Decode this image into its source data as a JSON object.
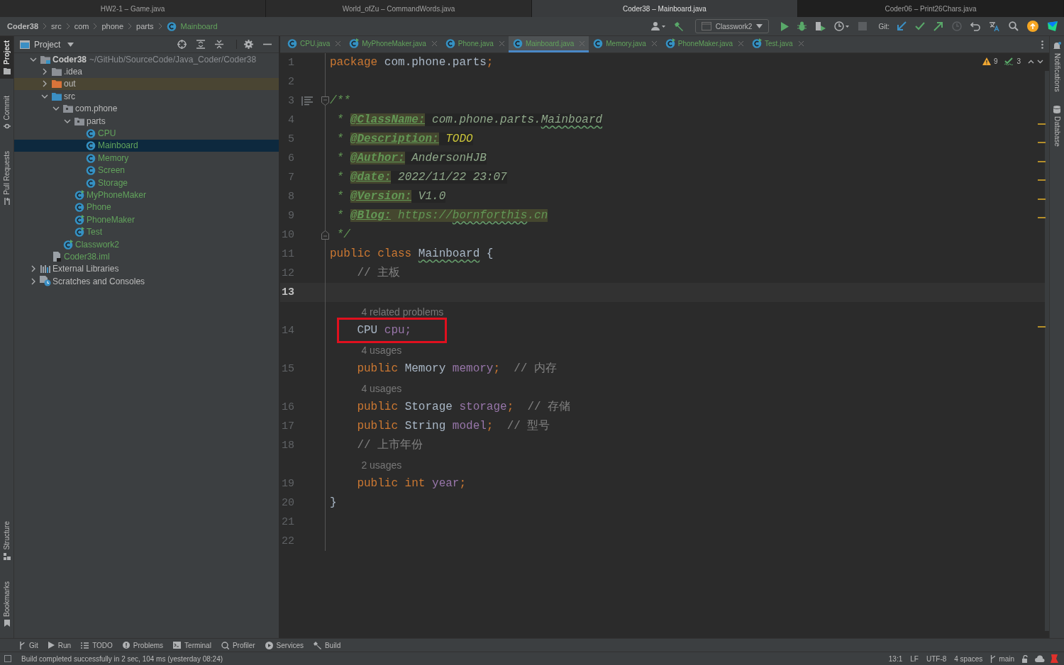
{
  "window_tabs": [
    {
      "label": "HW2-1 – Game.java",
      "selected": false
    },
    {
      "label": "World_ofZu – CommandWords.java",
      "selected": false
    },
    {
      "label": "Coder38 – Mainboard.java",
      "selected": true
    },
    {
      "label": "Coder06 – Print26Chars.java",
      "selected": false
    }
  ],
  "breadcrumb": [
    {
      "label": "Coder38",
      "kind": "project"
    },
    {
      "label": "src",
      "kind": "folder"
    },
    {
      "label": "com",
      "kind": "folder"
    },
    {
      "label": "phone",
      "kind": "folder"
    },
    {
      "label": "parts",
      "kind": "folder"
    },
    {
      "label": "Mainboard",
      "kind": "class"
    }
  ],
  "toolbar": {
    "run_config": "Classwork2",
    "git_label": "Git:"
  },
  "left_tools_top": [
    {
      "label": "Project",
      "selected": true,
      "kind": "project"
    },
    {
      "label": "Commit",
      "selected": false,
      "kind": "commit"
    },
    {
      "label": "Pull Requests",
      "selected": false,
      "kind": "pull"
    }
  ],
  "left_tools_bottom": [
    {
      "label": "Structure",
      "selected": false,
      "kind": "structure"
    },
    {
      "label": "Bookmarks",
      "selected": false,
      "kind": "bookmarks"
    }
  ],
  "right_tools": [
    {
      "label": "Notifications",
      "kind": "notifications"
    },
    {
      "label": "Database",
      "kind": "database"
    }
  ],
  "project_panel": {
    "title": "Project",
    "tree": [
      {
        "label": "Coder38",
        "kind": "module",
        "path": "~/GitHub/SourceCode/Java_Coder/Coder38",
        "expanded": true,
        "selected": false,
        "added": false,
        "children": [
          {
            "label": ".idea",
            "kind": "folder",
            "expanded": false,
            "selected": false,
            "added": false
          },
          {
            "label": "out",
            "kind": "excluded",
            "expanded": false,
            "selected": false,
            "added": false
          },
          {
            "label": "src",
            "kind": "source",
            "expanded": true,
            "selected": false,
            "added": false,
            "children": [
              {
                "label": "com.phone",
                "kind": "package",
                "expanded": true,
                "selected": false,
                "added": false,
                "children": [
                  {
                    "label": "parts",
                    "kind": "package",
                    "expanded": true,
                    "selected": false,
                    "added": false,
                    "children": [
                      {
                        "label": "CPU",
                        "kind": "class",
                        "selected": false,
                        "added": true
                      },
                      {
                        "label": "Mainboard",
                        "kind": "class",
                        "selected": true,
                        "added": true
                      },
                      {
                        "label": "Memory",
                        "kind": "class",
                        "selected": false,
                        "added": true
                      },
                      {
                        "label": "Screen",
                        "kind": "class",
                        "selected": false,
                        "added": true
                      },
                      {
                        "label": "Storage",
                        "kind": "class",
                        "selected": false,
                        "added": true
                      }
                    ]
                  },
                  {
                    "label": "MyPhoneMaker",
                    "kind": "main_class",
                    "selected": false,
                    "added": true
                  },
                  {
                    "label": "Phone",
                    "kind": "class",
                    "selected": false,
                    "added": true
                  },
                  {
                    "label": "PhoneMaker",
                    "kind": "main_class",
                    "selected": false,
                    "added": true
                  },
                  {
                    "label": "Test",
                    "kind": "main_class",
                    "selected": false,
                    "added": true
                  }
                ]
              },
              {
                "label": "Classwork2",
                "kind": "main_class",
                "selected": false,
                "added": true
              }
            ]
          },
          {
            "label": "Coder38.iml",
            "kind": "iml",
            "selected": false,
            "added": true
          }
        ]
      },
      {
        "label": "External Libraries",
        "kind": "libraries",
        "expanded": false,
        "selected": false,
        "added": false
      },
      {
        "label": "Scratches and Consoles",
        "kind": "scratches",
        "expanded": false,
        "selected": false,
        "added": false
      }
    ]
  },
  "editor_tabs": [
    {
      "label": "CPU.java",
      "kind": "class",
      "selected": false
    },
    {
      "label": "MyPhoneMaker.java",
      "kind": "main_class",
      "selected": false
    },
    {
      "label": "Phone.java",
      "kind": "class",
      "selected": false
    },
    {
      "label": "Mainboard.java",
      "kind": "class",
      "selected": true
    },
    {
      "label": "Memory.java",
      "kind": "class",
      "selected": false
    },
    {
      "label": "PhoneMaker.java",
      "kind": "main_class",
      "selected": false
    },
    {
      "label": "Test.java",
      "kind": "main_class",
      "selected": false
    }
  ],
  "inspections": {
    "warnings": "9",
    "typos": "3"
  },
  "code": [
    {
      "kind": "line",
      "number": "1",
      "tokens": [
        {
          "t": "package",
          "kind": "kw"
        },
        {
          "t": " com.phone.parts",
          "kind": "plain"
        },
        {
          "t": ";",
          "kind": "kw"
        }
      ]
    },
    {
      "kind": "line",
      "number": "2"
    },
    {
      "kind": "line",
      "number": "3",
      "doc_toggle": true,
      "fold_start": true,
      "tokens": [
        {
          "t": "/**",
          "kind": "doc"
        }
      ]
    },
    {
      "kind": "line",
      "number": "4",
      "tokens": [
        {
          "t": " * ",
          "kind": "doc"
        },
        {
          "t": "@ClassName:",
          "kind": "tag"
        },
        {
          "t": " com.phone.parts.",
          "kind": "docval"
        },
        {
          "t": "Mainboard",
          "kind": "docval_typo"
        }
      ]
    },
    {
      "kind": "line",
      "number": "5",
      "tokens": [
        {
          "t": " * ",
          "kind": "doc"
        },
        {
          "t": "@Description:",
          "kind": "tag"
        },
        {
          "t": " TODO",
          "kind": "todo"
        }
      ]
    },
    {
      "kind": "line",
      "number": "6",
      "tokens": [
        {
          "t": " * ",
          "kind": "doc"
        },
        {
          "t": "@Author:",
          "kind": "tag"
        },
        {
          "t": " AndersonHJB",
          "kind": "docval"
        }
      ]
    },
    {
      "kind": "line",
      "number": "7",
      "tokens": [
        {
          "t": " * ",
          "kind": "doc"
        },
        {
          "t": "@date:",
          "kind": "tag"
        },
        {
          "t": " 2022/11/22 23:07",
          "kind": "docval"
        }
      ]
    },
    {
      "kind": "line",
      "number": "8",
      "tokens": [
        {
          "t": " * ",
          "kind": "doc"
        },
        {
          "t": "@Version:",
          "kind": "tag"
        },
        {
          "t": " V1.0",
          "kind": "docval"
        }
      ]
    },
    {
      "kind": "line",
      "number": "9",
      "tokens": [
        {
          "t": " * ",
          "kind": "doc"
        },
        {
          "t": "@Blog:",
          "kind": "tag"
        },
        {
          "t": " https://",
          "kind": "link"
        },
        {
          "t": "bornforthis",
          "kind": "link_typo"
        },
        {
          "t": ".cn",
          "kind": "link"
        }
      ]
    },
    {
      "kind": "line",
      "number": "10",
      "fold_end": true,
      "tokens": [
        {
          "t": " */",
          "kind": "doc"
        }
      ]
    },
    {
      "kind": "line",
      "number": "11",
      "tokens": [
        {
          "t": "public class ",
          "kind": "kw"
        },
        {
          "t": "Mainboard",
          "kind": "plain_typo"
        },
        {
          "t": " {",
          "kind": "plain"
        }
      ]
    },
    {
      "kind": "line",
      "number": "12",
      "tokens": [
        {
          "t": "    // 主板",
          "kind": "comment"
        }
      ]
    },
    {
      "kind": "line",
      "number": "13",
      "current": true
    },
    {
      "kind": "hint",
      "text": "4 related problems"
    },
    {
      "kind": "line",
      "number": "14",
      "boxed": true,
      "tokens": [
        {
          "t": "    CPU ",
          "kind": "plain"
        },
        {
          "t": "cpu;",
          "kind": "field"
        }
      ]
    },
    {
      "kind": "hint",
      "text": "4 usages"
    },
    {
      "kind": "line",
      "number": "15",
      "tokens": [
        {
          "t": "    public ",
          "kind": "kw"
        },
        {
          "t": "Memory ",
          "kind": "plain"
        },
        {
          "t": "memory",
          "kind": "field"
        },
        {
          "t": ";",
          "kind": "kw"
        },
        {
          "t": "  // 内存",
          "kind": "comment"
        }
      ]
    },
    {
      "kind": "hint",
      "text": "4 usages"
    },
    {
      "kind": "line",
      "number": "16",
      "tokens": [
        {
          "t": "    public ",
          "kind": "kw"
        },
        {
          "t": "Storage ",
          "kind": "plain"
        },
        {
          "t": "storage",
          "kind": "field"
        },
        {
          "t": ";",
          "kind": "kw"
        },
        {
          "t": "  // 存储",
          "kind": "comment"
        }
      ]
    },
    {
      "kind": "line",
      "number": "17",
      "tokens": [
        {
          "t": "    public ",
          "kind": "kw"
        },
        {
          "t": "String ",
          "kind": "plain"
        },
        {
          "t": "model",
          "kind": "field"
        },
        {
          "t": ";",
          "kind": "kw"
        },
        {
          "t": "  // 型号",
          "kind": "comment"
        }
      ]
    },
    {
      "kind": "line",
      "number": "18",
      "tokens": [
        {
          "t": "    // 上市年份",
          "kind": "comment"
        }
      ]
    },
    {
      "kind": "hint",
      "text": "2 usages"
    },
    {
      "kind": "line",
      "number": "19",
      "tokens": [
        {
          "t": "    public int ",
          "kind": "kw"
        },
        {
          "t": "year",
          "kind": "field"
        },
        {
          "t": ";",
          "kind": "kw"
        }
      ]
    },
    {
      "kind": "line",
      "number": "20",
      "tokens": [
        {
          "t": "}",
          "kind": "plain"
        }
      ]
    },
    {
      "kind": "line",
      "number": "21"
    },
    {
      "kind": "line",
      "number": "22"
    }
  ],
  "bottom_tools": [
    {
      "label": "Git",
      "kind": "git"
    },
    {
      "label": "Run",
      "kind": "run"
    },
    {
      "label": "TODO",
      "kind": "todo"
    },
    {
      "label": "Problems",
      "kind": "problems"
    },
    {
      "label": "Terminal",
      "kind": "terminal"
    },
    {
      "label": "Profiler",
      "kind": "profiler"
    },
    {
      "label": "Services",
      "kind": "services"
    },
    {
      "label": "Build",
      "kind": "build"
    }
  ],
  "status_bar": {
    "message": "Build completed successfully in 2 sec, 104 ms (yesterday 08:24)",
    "position": "13:1",
    "line_separator": "LF",
    "encoding": "UTF-8",
    "indent": "4 spaces",
    "branch": "main"
  }
}
